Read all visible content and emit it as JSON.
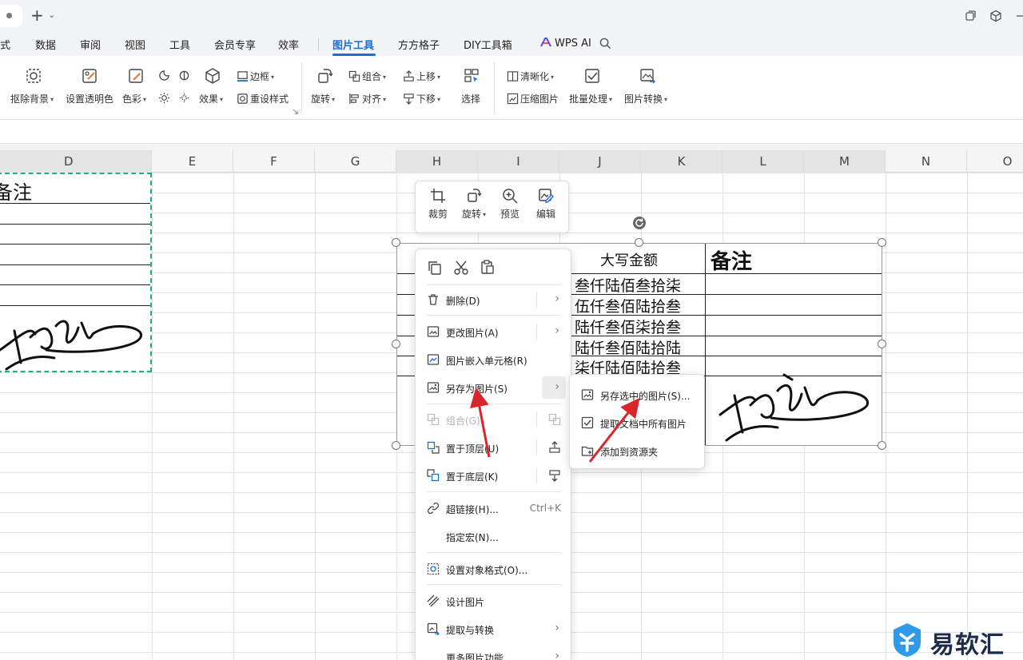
{
  "titlebar": {
    "new_tab": "+",
    "tab_menu": "⌄"
  },
  "menubar": {
    "items": [
      "式",
      "数据",
      "审阅",
      "视图",
      "工具",
      "会员专享",
      "效率",
      "图片工具",
      "方方格子",
      "DIY工具箱",
      "WPS AI"
    ],
    "active": "图片工具"
  },
  "ribbon": {
    "remove_bg": "抠除背景",
    "set_transparent": "设置透明色",
    "color": "色彩",
    "effect": "效果",
    "border": "边框",
    "reset_style": "重设样式",
    "rotate": "旋转",
    "group": "组合",
    "align": "对齐",
    "move_up": "上移",
    "move_down": "下移",
    "select": "选择",
    "sharpen": "清晰化",
    "compress": "压缩图片",
    "batch": "批量处理",
    "convert": "图片转换"
  },
  "columns": [
    "D",
    "E",
    "F",
    "G",
    "H",
    "I",
    "J",
    "K",
    "L",
    "M",
    "N",
    "O"
  ],
  "left_image": {
    "caption": "备注"
  },
  "picture": {
    "header_amount": "大写金额",
    "header_remark": "备注",
    "amounts": [
      "叁仟陆佰叁拾柒",
      "伍仟叁佰陆拾叁",
      "陆仟叁佰柒拾叁",
      "陆仟叁佰陆拾陆",
      "柒仟陆佰陆拾叁"
    ]
  },
  "float_toolbar": {
    "crop": "裁剪",
    "rotate": "旋转",
    "preview": "预览",
    "edit": "编辑"
  },
  "context_menu": {
    "delete": "删除(D)",
    "change_picture": "更改图片(A)",
    "embed_cell": "图片嵌入单元格(R)",
    "save_as_picture": "另存为图片(S)",
    "group": "组合(G)",
    "bring_front": "置于顶层(U)",
    "send_back": "置于底层(K)",
    "hyperlink": "超链接(H)...",
    "hyperlink_shortcut": "Ctrl+K",
    "assign_macro": "指定宏(N)...",
    "format_object": "设置对象格式(O)...",
    "design_picture": "设计图片",
    "extract_convert": "提取与转换",
    "more_functions": "更多图片功能"
  },
  "submenu": {
    "save_selected": "另存选中的图片(S)...",
    "extract_all": "提取文档中所有图片",
    "add_to_resources": "添加到资源夹"
  },
  "watermark": {
    "text": "易软汇"
  },
  "colors": {
    "accent": "#1b6fd8",
    "selection_dash": "#2bab7a",
    "arrow": "#d8262b"
  }
}
